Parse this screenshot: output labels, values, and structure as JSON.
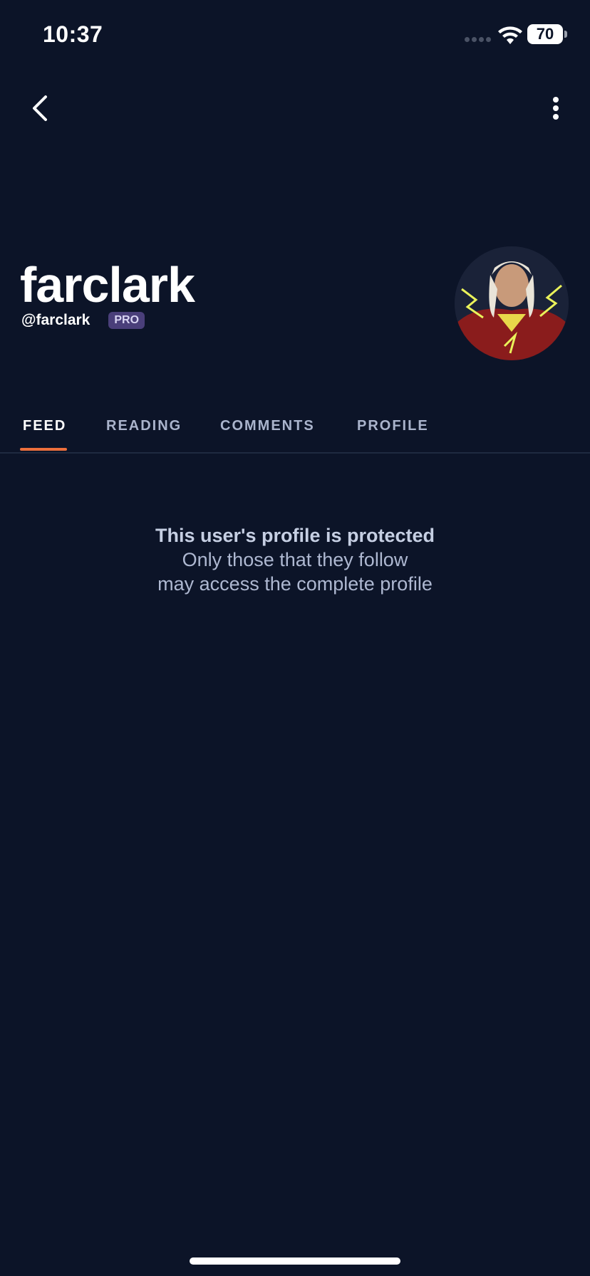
{
  "status_bar": {
    "time": "10:37",
    "battery": "70"
  },
  "profile": {
    "display_name": "farclark",
    "handle": "@farclark",
    "badge": "PRO"
  },
  "tabs": [
    {
      "label": "FEED",
      "active": true
    },
    {
      "label": "READING",
      "active": false
    },
    {
      "label": "COMMENTS",
      "active": false
    },
    {
      "label": "PROFILE",
      "active": false
    }
  ],
  "message": {
    "title": "This user's profile is protected",
    "line1": "Only those that they follow",
    "line2": "may access the complete profile"
  },
  "colors": {
    "background": "#0c1428",
    "accent": "#ec6f3c",
    "badge_bg": "#4a3f7a"
  },
  "icons": {
    "back": "chevron-left-icon",
    "more": "more-vertical-icon",
    "wifi": "wifi-icon"
  }
}
